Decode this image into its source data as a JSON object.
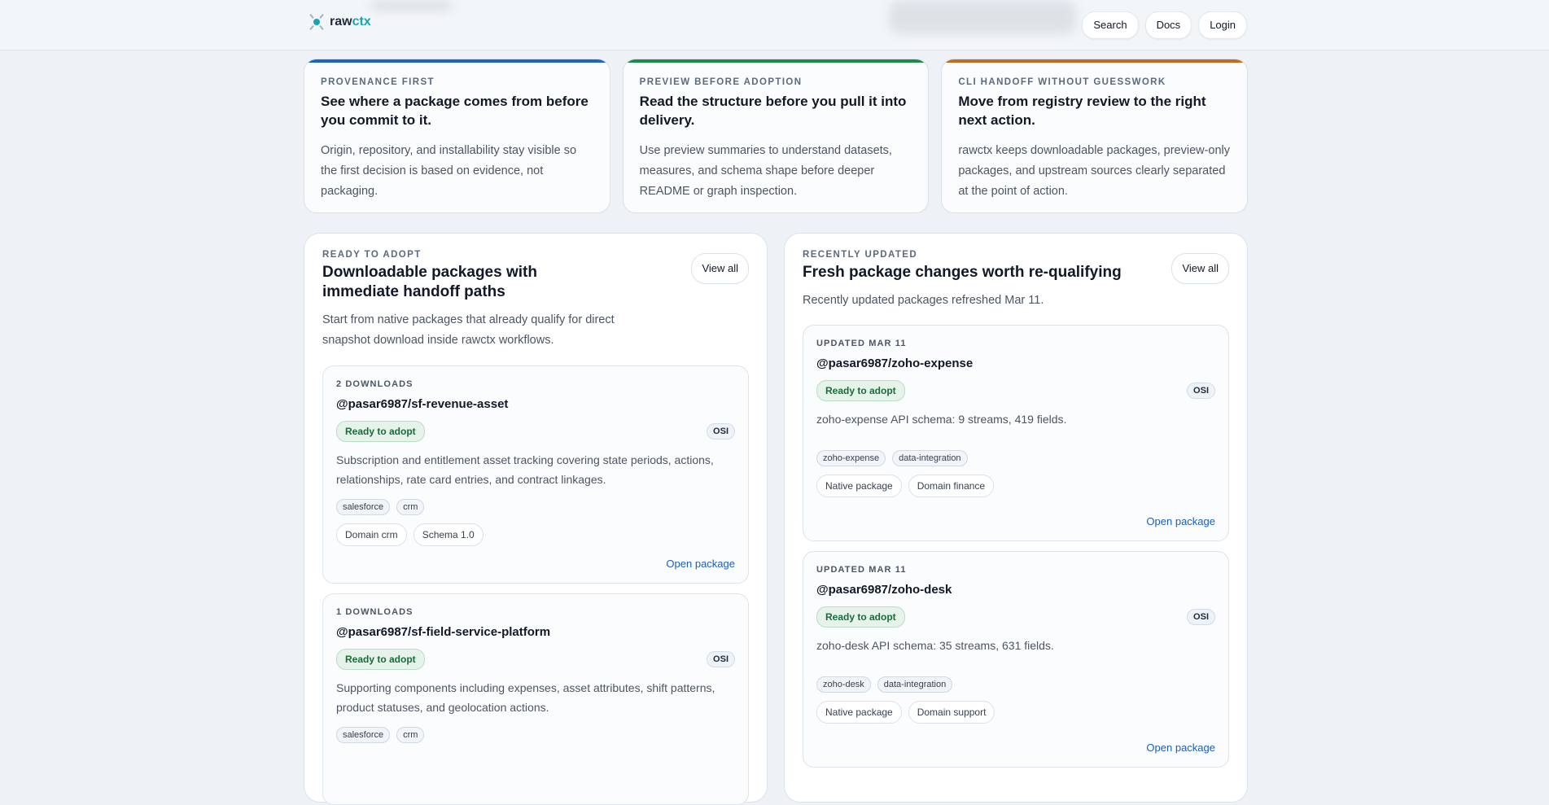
{
  "header": {
    "logo_part1": "raw",
    "logo_part2": "ctx",
    "nav": [
      "Search",
      "Docs",
      "Login"
    ]
  },
  "features": [
    {
      "eyebrow": "PROVENANCE FIRST",
      "title": "See where a package comes from before you commit to it.",
      "text": "Origin, repository, and installability stay visible so the first decision is based on evidence, not packaging.",
      "accent": "#1e63c6"
    },
    {
      "eyebrow": "PREVIEW BEFORE ADOPTION",
      "title": "Read the structure before you pull it into delivery.",
      "text": "Use preview summaries to understand datasets, measures, and schema shape before deeper README or graph inspection.",
      "accent": "#1e8a4a"
    },
    {
      "eyebrow": "CLI HANDOFF WITHOUT GUESSWORK",
      "title": "Move from registry review to the right next action.",
      "text": "rawctx keeps downloadable packages, preview-only packages, and upstream sources clearly separated at the point of action.",
      "accent": "#c26a1e"
    }
  ],
  "ready": {
    "eyebrow": "READY TO ADOPT",
    "title": "Downloadable packages with immediate handoff paths",
    "subtitle": "Start from native packages that already qualify for direct snapshot download inside rawctx workflows.",
    "view_all": "View all",
    "cards": [
      {
        "meta": "2 DOWNLOADS",
        "name": "@pasar6987/sf-revenue-asset",
        "status": "Ready to adopt",
        "license": "OSI",
        "desc": "Subscription and entitlement asset tracking covering state periods, actions, relationships, rate card entries, and contract linkages.",
        "tags": [
          "salesforce",
          "crm"
        ],
        "pills": [
          "Domain crm",
          "Schema 1.0"
        ],
        "link": "Open package"
      },
      {
        "meta": "1 DOWNLOADS",
        "name": "@pasar6987/sf-field-service-platform",
        "status": "Ready to adopt",
        "license": "OSI",
        "desc": "Supporting components including expenses, asset attributes, shift patterns, product statuses, and geolocation actions.",
        "tags": [
          "salesforce",
          "crm"
        ]
      }
    ]
  },
  "recent": {
    "eyebrow": "RECENTLY UPDATED",
    "title": "Fresh package changes worth re-qualifying",
    "subtitle": "Recently updated packages refreshed Mar 11.",
    "view_all": "View all",
    "cards": [
      {
        "meta": "UPDATED MAR 11",
        "name": "@pasar6987/zoho-expense",
        "status": "Ready to adopt",
        "license": "OSI",
        "desc": "zoho-expense API schema: 9 streams, 419 fields.",
        "tags": [
          "zoho-expense",
          "data-integration"
        ],
        "pills": [
          "Native package",
          "Domain finance"
        ],
        "link": "Open package"
      },
      {
        "meta": "UPDATED MAR 11",
        "name": "@pasar6987/zoho-desk",
        "status": "Ready to adopt",
        "license": "OSI",
        "desc": "zoho-desk API schema: 35 streams, 631 fields.",
        "tags": [
          "zoho-desk",
          "data-integration"
        ],
        "pills": [
          "Native package",
          "Domain support"
        ],
        "link": "Open package"
      }
    ]
  }
}
